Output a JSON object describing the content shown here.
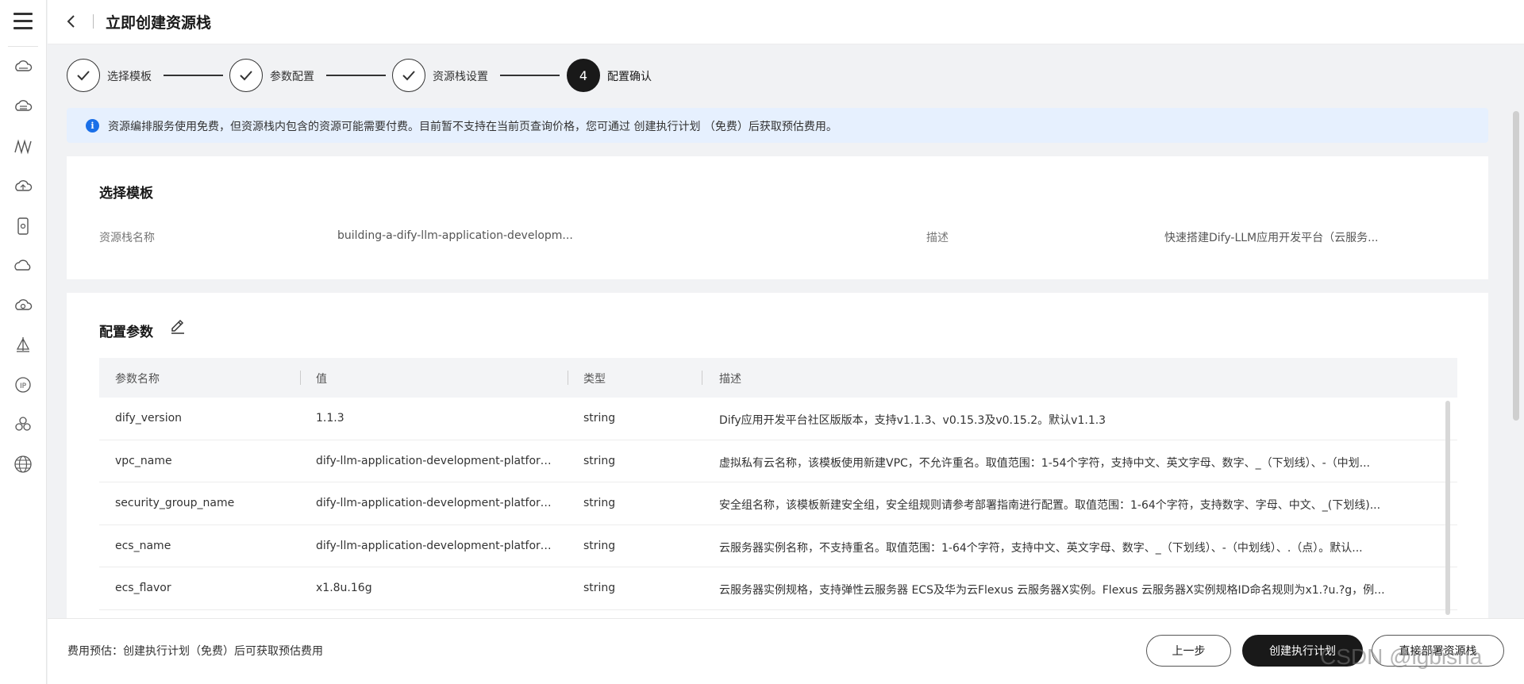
{
  "header": {
    "title": "立即创建资源栈"
  },
  "steps": [
    {
      "label": "选择模板",
      "state": "done"
    },
    {
      "label": "参数配置",
      "state": "done"
    },
    {
      "label": "资源栈设置",
      "state": "done"
    },
    {
      "label": "配置确认",
      "number": "4",
      "state": "active"
    }
  ],
  "banner": {
    "text": "资源编排服务使用免费，但资源栈内包含的资源可能需要付费。目前暂不支持在当前页查询价格，您可通过 创建执行计划 （免费）后获取预估费用。"
  },
  "template_section": {
    "title": "选择模板",
    "stack_name_label": "资源栈名称",
    "stack_name_value": "building-a-dify-llm-application-developm...",
    "desc_label": "描述",
    "desc_value": "快速搭建Dify-LLM应用开发平台（云服务..."
  },
  "params_section": {
    "title": "配置参数",
    "columns": [
      "参数名称",
      "值",
      "类型",
      "描述"
    ],
    "rows": [
      {
        "name": "dify_version",
        "value": "1.1.3",
        "type": "string",
        "desc": "Dify应用开发平台社区版版本，支持v1.1.3、v0.15.3及v0.15.2。默认v1.1.3"
      },
      {
        "name": "vpc_name",
        "value": "dify-llm-application-development-platform-...",
        "type": "string",
        "desc": "虚拟私有云名称，该模板使用新建VPC，不允许重名。取值范围：1-54个字符，支持中文、英文字母、数字、_（下划线）、-（中划..."
      },
      {
        "name": "security_group_name",
        "value": "dify-llm-application-development-platform-...",
        "type": "string",
        "desc": "安全组名称，该模板新建安全组，安全组规则请参考部署指南进行配置。取值范围：1-64个字符，支持数字、字母、中文、_(下划线)..."
      },
      {
        "name": "ecs_name",
        "value": "dify-llm-application-development-platform-...",
        "type": "string",
        "desc": "云服务器实例名称，不支持重名。取值范围：1-64个字符，支持中文、英文字母、数字、_（下划线）、-（中划线）、.（点）。默认..."
      },
      {
        "name": "ecs_flavor",
        "value": "x1.8u.16g",
        "type": "string",
        "desc": "云服务器实例规格，支持弹性云服务器 ECS及华为云Flexus 云服务器X实例。Flexus 云服务器X实例规格ID命名规则为x1.?u.?g，例..."
      }
    ]
  },
  "footer": {
    "estimate": "费用预估：创建执行计划（免费）后可获取预估费用",
    "prev": "上一步",
    "create_plan": "创建执行计划",
    "deploy": "直接部署资源栈"
  },
  "watermark": "CSDN @lgbisha"
}
